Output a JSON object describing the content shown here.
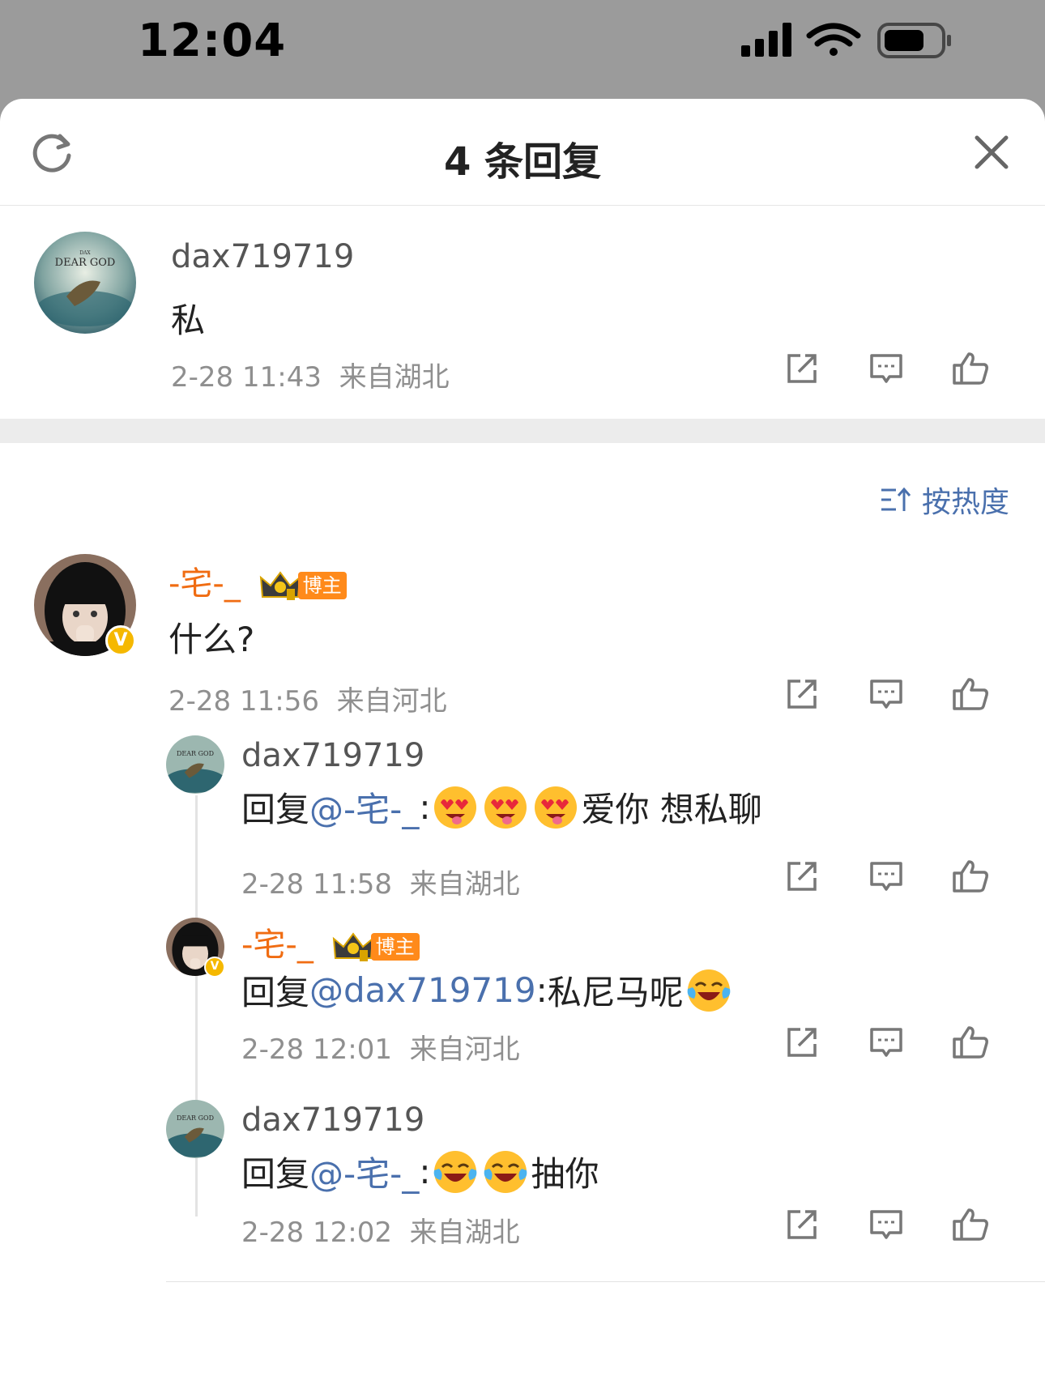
{
  "status": {
    "time": "12:04"
  },
  "header": {
    "title": "4 条回复"
  },
  "main_comment": {
    "username": "dax719719",
    "avatar_text": "DEAR GOD",
    "text": "私",
    "date": "2-28 11:43",
    "location": "来自湖北"
  },
  "sort": {
    "label": "按热度"
  },
  "thread": {
    "root": {
      "username": "-宅-_",
      "badge": "博主",
      "text": "什么?",
      "date": "2-28 11:56",
      "location": "来自河北",
      "verified": "V"
    },
    "replies": [
      {
        "username": "dax719719",
        "avatar_text": "DEAR GOD",
        "prefix": "回复",
        "mention": "@-宅-_",
        "sep": ":",
        "emojis": [
          "heart-eyes",
          "heart-eyes",
          "heart-eyes"
        ],
        "text": "爱你 想私聊",
        "date": "2-28 11:58",
        "location": "来自湖北"
      },
      {
        "username": "-宅-_",
        "badge": "博主",
        "verified": "V",
        "prefix": "回复",
        "mention": "@dax719719",
        "sep": ":",
        "text": "私尼马呢",
        "emojis": [
          "tears-of-joy"
        ],
        "date": "2-28 12:01",
        "location": "来自河北"
      },
      {
        "username": "dax719719",
        "avatar_text": "DEAR GOD",
        "prefix": "回复",
        "mention": "@-宅-_",
        "sep": ":",
        "emojis": [
          "tears-of-joy",
          "tears-of-joy"
        ],
        "text": "抽你",
        "date": "2-28 12:02",
        "location": "来自湖北"
      }
    ]
  },
  "colors": {
    "accent": "#4a70ad",
    "orange": "#f06c12",
    "meta": "#8f8f8f"
  }
}
